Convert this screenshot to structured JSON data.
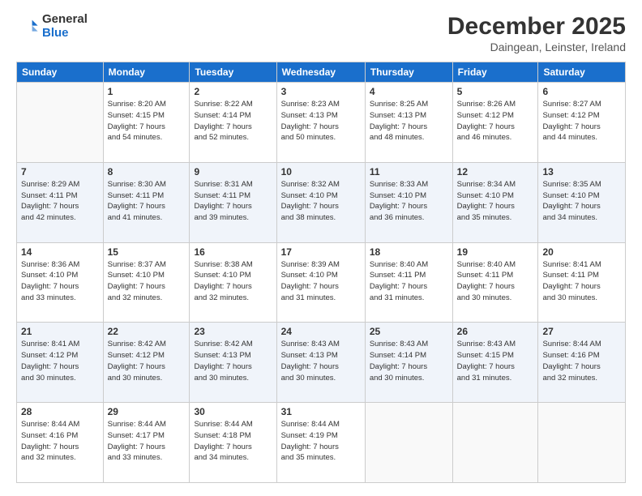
{
  "header": {
    "logo_general": "General",
    "logo_blue": "Blue",
    "month_title": "December 2025",
    "subtitle": "Daingean, Leinster, Ireland"
  },
  "days_of_week": [
    "Sunday",
    "Monday",
    "Tuesday",
    "Wednesday",
    "Thursday",
    "Friday",
    "Saturday"
  ],
  "weeks": [
    [
      {
        "day": "",
        "info": ""
      },
      {
        "day": "1",
        "info": "Sunrise: 8:20 AM\nSunset: 4:15 PM\nDaylight: 7 hours\nand 54 minutes."
      },
      {
        "day": "2",
        "info": "Sunrise: 8:22 AM\nSunset: 4:14 PM\nDaylight: 7 hours\nand 52 minutes."
      },
      {
        "day": "3",
        "info": "Sunrise: 8:23 AM\nSunset: 4:13 PM\nDaylight: 7 hours\nand 50 minutes."
      },
      {
        "day": "4",
        "info": "Sunrise: 8:25 AM\nSunset: 4:13 PM\nDaylight: 7 hours\nand 48 minutes."
      },
      {
        "day": "5",
        "info": "Sunrise: 8:26 AM\nSunset: 4:12 PM\nDaylight: 7 hours\nand 46 minutes."
      },
      {
        "day": "6",
        "info": "Sunrise: 8:27 AM\nSunset: 4:12 PM\nDaylight: 7 hours\nand 44 minutes."
      }
    ],
    [
      {
        "day": "7",
        "info": "Sunrise: 8:29 AM\nSunset: 4:11 PM\nDaylight: 7 hours\nand 42 minutes."
      },
      {
        "day": "8",
        "info": "Sunrise: 8:30 AM\nSunset: 4:11 PM\nDaylight: 7 hours\nand 41 minutes."
      },
      {
        "day": "9",
        "info": "Sunrise: 8:31 AM\nSunset: 4:11 PM\nDaylight: 7 hours\nand 39 minutes."
      },
      {
        "day": "10",
        "info": "Sunrise: 8:32 AM\nSunset: 4:10 PM\nDaylight: 7 hours\nand 38 minutes."
      },
      {
        "day": "11",
        "info": "Sunrise: 8:33 AM\nSunset: 4:10 PM\nDaylight: 7 hours\nand 36 minutes."
      },
      {
        "day": "12",
        "info": "Sunrise: 8:34 AM\nSunset: 4:10 PM\nDaylight: 7 hours\nand 35 minutes."
      },
      {
        "day": "13",
        "info": "Sunrise: 8:35 AM\nSunset: 4:10 PM\nDaylight: 7 hours\nand 34 minutes."
      }
    ],
    [
      {
        "day": "14",
        "info": "Sunrise: 8:36 AM\nSunset: 4:10 PM\nDaylight: 7 hours\nand 33 minutes."
      },
      {
        "day": "15",
        "info": "Sunrise: 8:37 AM\nSunset: 4:10 PM\nDaylight: 7 hours\nand 32 minutes."
      },
      {
        "day": "16",
        "info": "Sunrise: 8:38 AM\nSunset: 4:10 PM\nDaylight: 7 hours\nand 32 minutes."
      },
      {
        "day": "17",
        "info": "Sunrise: 8:39 AM\nSunset: 4:10 PM\nDaylight: 7 hours\nand 31 minutes."
      },
      {
        "day": "18",
        "info": "Sunrise: 8:40 AM\nSunset: 4:11 PM\nDaylight: 7 hours\nand 31 minutes."
      },
      {
        "day": "19",
        "info": "Sunrise: 8:40 AM\nSunset: 4:11 PM\nDaylight: 7 hours\nand 30 minutes."
      },
      {
        "day": "20",
        "info": "Sunrise: 8:41 AM\nSunset: 4:11 PM\nDaylight: 7 hours\nand 30 minutes."
      }
    ],
    [
      {
        "day": "21",
        "info": "Sunrise: 8:41 AM\nSunset: 4:12 PM\nDaylight: 7 hours\nand 30 minutes."
      },
      {
        "day": "22",
        "info": "Sunrise: 8:42 AM\nSunset: 4:12 PM\nDaylight: 7 hours\nand 30 minutes."
      },
      {
        "day": "23",
        "info": "Sunrise: 8:42 AM\nSunset: 4:13 PM\nDaylight: 7 hours\nand 30 minutes."
      },
      {
        "day": "24",
        "info": "Sunrise: 8:43 AM\nSunset: 4:13 PM\nDaylight: 7 hours\nand 30 minutes."
      },
      {
        "day": "25",
        "info": "Sunrise: 8:43 AM\nSunset: 4:14 PM\nDaylight: 7 hours\nand 30 minutes."
      },
      {
        "day": "26",
        "info": "Sunrise: 8:43 AM\nSunset: 4:15 PM\nDaylight: 7 hours\nand 31 minutes."
      },
      {
        "day": "27",
        "info": "Sunrise: 8:44 AM\nSunset: 4:16 PM\nDaylight: 7 hours\nand 32 minutes."
      }
    ],
    [
      {
        "day": "28",
        "info": "Sunrise: 8:44 AM\nSunset: 4:16 PM\nDaylight: 7 hours\nand 32 minutes."
      },
      {
        "day": "29",
        "info": "Sunrise: 8:44 AM\nSunset: 4:17 PM\nDaylight: 7 hours\nand 33 minutes."
      },
      {
        "day": "30",
        "info": "Sunrise: 8:44 AM\nSunset: 4:18 PM\nDaylight: 7 hours\nand 34 minutes."
      },
      {
        "day": "31",
        "info": "Sunrise: 8:44 AM\nSunset: 4:19 PM\nDaylight: 7 hours\nand 35 minutes."
      },
      {
        "day": "",
        "info": ""
      },
      {
        "day": "",
        "info": ""
      },
      {
        "day": "",
        "info": ""
      }
    ]
  ]
}
